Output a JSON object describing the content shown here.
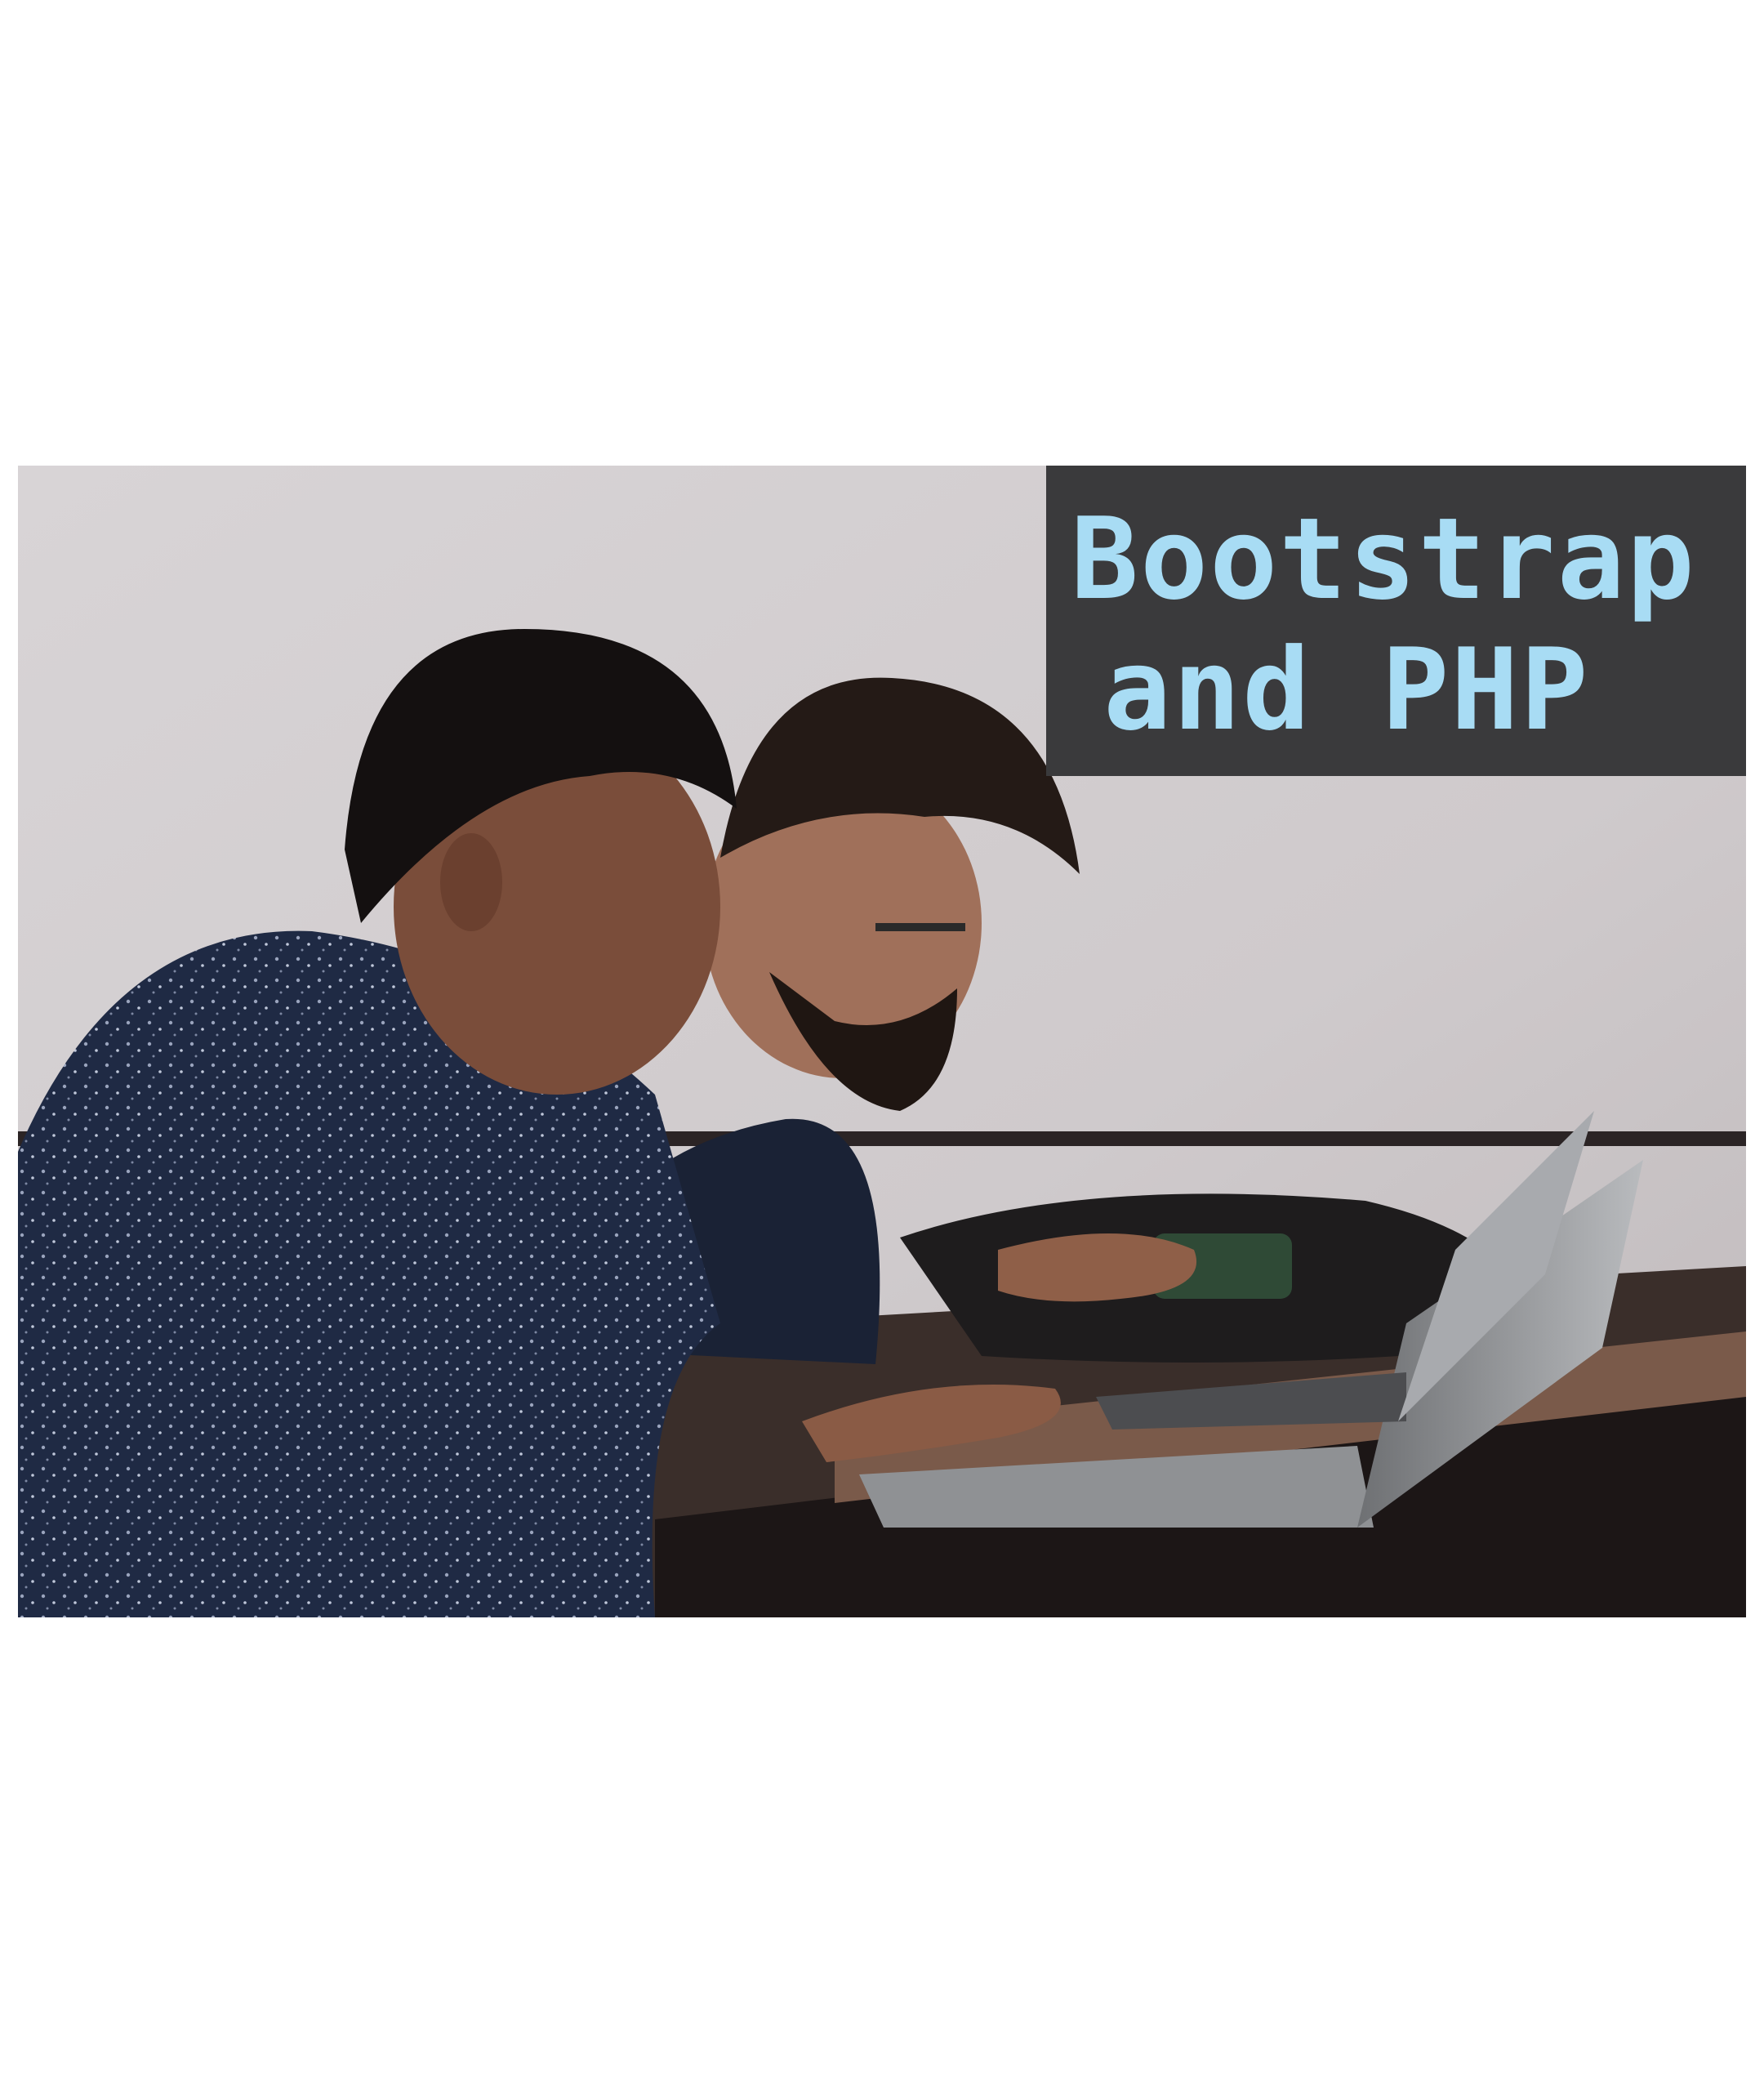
{
  "banner": {
    "line1": "Bootstrap",
    "line2": "and PHP",
    "background_color": "#3a3a3c",
    "text_color": "#a8dcf4"
  },
  "photo": {
    "subject": "two-men-working-on-laptops",
    "background_color": "#ffffff"
  }
}
